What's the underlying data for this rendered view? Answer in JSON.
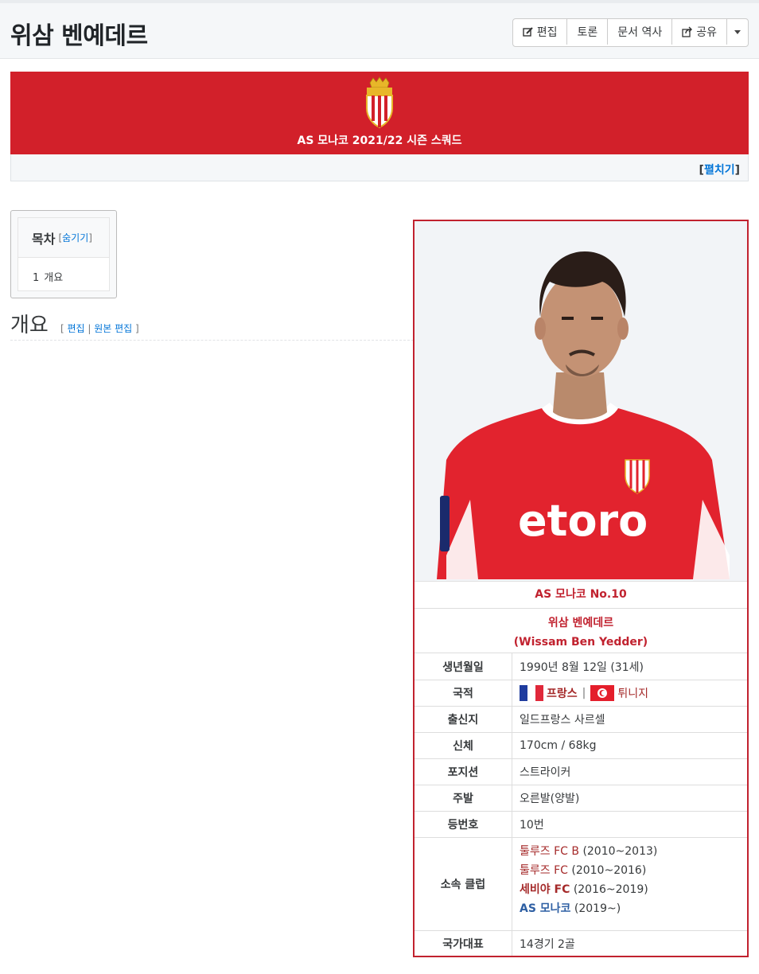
{
  "header": {
    "title": "위삼 벤예데르",
    "buttons": {
      "edit": "편집",
      "discuss": "토론",
      "history": "문서 역사",
      "share": "공유"
    }
  },
  "navbox": {
    "title": "AS 모나코 2021/22 시즌 스쿼드",
    "toggle": "펼치기"
  },
  "toc": {
    "title": "목차",
    "hide": "숨기기",
    "items": [
      {
        "num": "1",
        "label": "개요"
      }
    ]
  },
  "section": {
    "title": "개요",
    "edit": "편집",
    "raw_edit": "원본 편집"
  },
  "infobox": {
    "team_number": "AS 모나코 No.10",
    "name_ko": "위삼 벤예데르",
    "name_en": "(Wissam Ben Yedder)",
    "rows": {
      "birth": {
        "label": "생년월일",
        "value": "1990년 8월 12일 (31세)"
      },
      "nationality": {
        "label": "국적",
        "country1": "프랑스",
        "country2": "튀니지"
      },
      "birthplace": {
        "label": "출신지",
        "value": "일드프랑스 사르셀"
      },
      "body": {
        "label": "신체",
        "value": "170cm / 68kg"
      },
      "position": {
        "label": "포지션",
        "value": "스트라이커"
      },
      "foot": {
        "label": "주발",
        "value": "오른발(양발)"
      },
      "number": {
        "label": "등번호",
        "value": "10번"
      },
      "clubs": {
        "label": "소속 클럽",
        "list": [
          {
            "name": "툴루즈 FC B",
            "years": "(2010~2013)"
          },
          {
            "name": "툴루즈 FC",
            "years": "(2010~2016)"
          },
          {
            "name": "세비야 FC",
            "years": "(2016~2019)"
          },
          {
            "name": "AS 모나코",
            "years": "(2019~)"
          }
        ]
      },
      "national": {
        "label": "국가대표",
        "value": "14경기 2골"
      }
    }
  },
  "colors": {
    "monaco_red": "#d2202a",
    "infobox_border": "#c1222f",
    "link_blue": "#0275d8"
  }
}
